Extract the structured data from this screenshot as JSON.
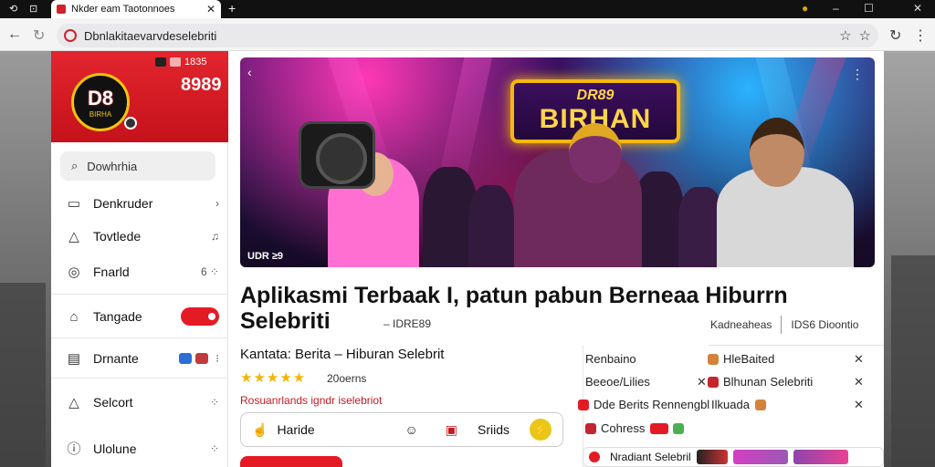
{
  "browser": {
    "tab_title": "Nkder eam Taotonnoes",
    "tab_close": "✕",
    "new_tab": "+",
    "url": "Dbnlakitaevarvdeselebriti",
    "icons": [
      "back-arrow",
      "reload",
      "star-outline",
      "star-outline",
      "reload"
    ]
  },
  "sidebar": {
    "brand_big": "D8",
    "brand_small": "BIRHA",
    "brand_top": "1835",
    "brand_num": "8989",
    "search_placeholder": "Dowhrhia",
    "items": [
      {
        "label": "Denkruder",
        "trail": "›"
      },
      {
        "label": "Tovtlede",
        "trail": "♫"
      },
      {
        "label": "Fnarld",
        "trail": "6 ⁘"
      },
      {
        "label": "Tangade",
        "trail": ""
      },
      {
        "label": "Drnante",
        "trail": "⁝"
      },
      {
        "label": "Selcort",
        "trail": "⁘"
      },
      {
        "label": "Ulolune",
        "trail": "⁘"
      }
    ]
  },
  "hero": {
    "sign_small": "DR89",
    "sign_big": "BIRHAN",
    "tag": "UDR ≥9",
    "accent": "#f6b70f"
  },
  "article": {
    "title_line1": "Aplikasmi Terbaak  I, patun  pabun Berneaa Hiburrn",
    "title_line2": "Selebriti",
    "title_suffix": "– IDRE89",
    "meta_left": "Kadneaheas",
    "meta_right": "IDS6 Dioontio",
    "kategori": "Kantata: Berita – Hiburan Selebrit",
    "stars": "★★★★★",
    "rating": "20oerns",
    "red_note": "Rosuanrlands igndr iselebriot",
    "action_left": "Haride",
    "action_mid": "Sriids"
  },
  "right_list": [
    {
      "left": "Renbaino",
      "right": "HleBaited",
      "x": "✕"
    },
    {
      "left": "Beeoe/Lilies",
      "right": "Blhunan Selebriti",
      "x": "✕"
    },
    {
      "left": "Dde Berits Rennengbl",
      "right": "Ilkuada",
      "x": "✕"
    },
    {
      "left": "Cohress",
      "right": "",
      "x": ""
    }
  ],
  "thumb_label": "Nradiant Selebril",
  "colors": {
    "brand_red": "#e41b25",
    "gold": "#f4b400"
  }
}
